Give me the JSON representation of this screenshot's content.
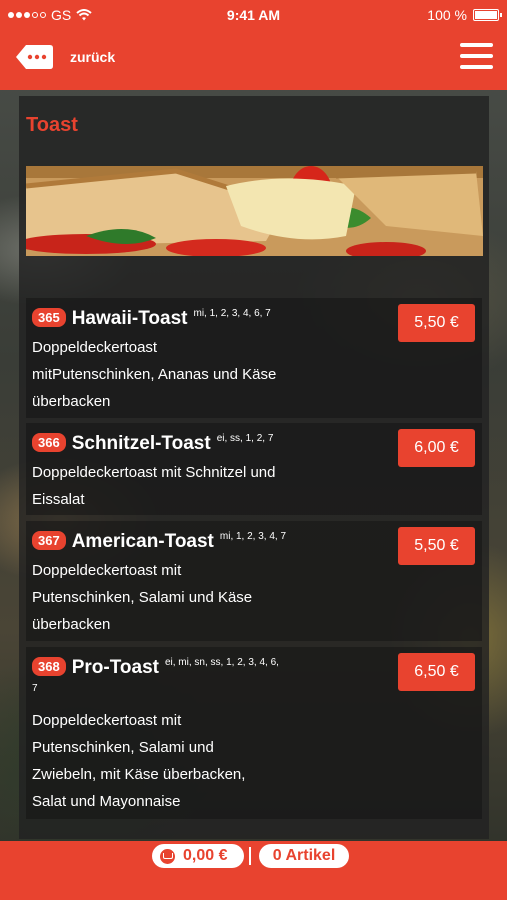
{
  "status_bar": {
    "carrier": "GS",
    "time": "9:41 AM",
    "battery": "100 %",
    "battery_level": 1.0
  },
  "nav": {
    "back_label": "zurück"
  },
  "section": {
    "title": "Toast"
  },
  "items": [
    {
      "number": "365",
      "name": "Hawaii-Toast",
      "allergens": "mi, 1, 2, 3, 4, 6, 7",
      "desc_lines": [
        "Doppeldeckertoast",
        "mitPutenschinken, Ananas und Käse",
        "überbacken"
      ],
      "price": "5,50 €"
    },
    {
      "number": "366",
      "name": "Schnitzel-Toast",
      "allergens": "ei, ss, 1, 2, 7",
      "desc_lines": [
        "Doppeldeckertoast mit Schnitzel und",
        "Eissalat"
      ],
      "price": "6,00 €"
    },
    {
      "number": "367",
      "name": "American-Toast",
      "allergens": "mi, 1, 2, 3, 4, 7",
      "desc_lines": [
        "Doppeldeckertoast mit",
        "Putenschinken, Salami und Käse",
        "überbacken"
      ],
      "price": "5,50 €"
    },
    {
      "number": "368",
      "name": "Pro-Toast",
      "allergens": "ei, mi, sn, ss, 1, 2, 3, 4, 6,",
      "allergens_cont": "7",
      "desc_lines": [
        "Doppeldeckertoast mit",
        "Putenschinken, Salami und",
        "Zwiebeln, mit Käse überbacken,",
        "Salat und Mayonnaise"
      ],
      "price": "6,50 €"
    }
  ],
  "cart": {
    "total": "0,00 €",
    "count": "0 Artikel"
  },
  "colors": {
    "accent": "#e8432f",
    "panel": "#222222",
    "text": "#ffffff"
  },
  "icons": {
    "back": "back-bubble-icon",
    "menu": "hamburger-menu-icon",
    "cart": "cart-icon",
    "wifi": "wifi-icon",
    "battery": "battery-icon"
  }
}
